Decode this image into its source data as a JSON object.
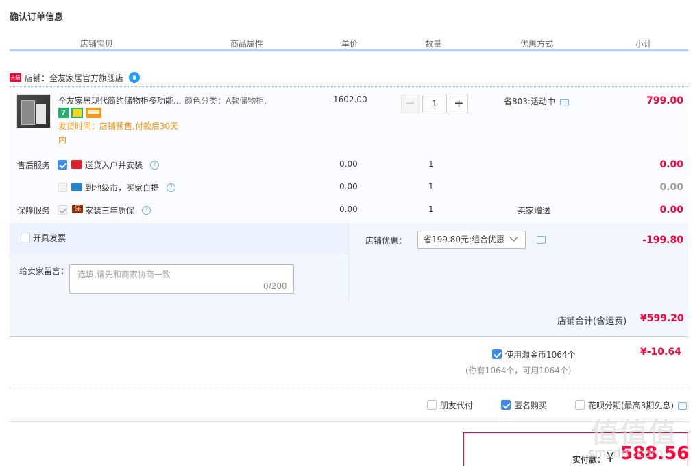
{
  "page": {
    "title": "确认订单信息"
  },
  "table_headers": [
    "店铺宝贝",
    "商品属性",
    "单价",
    "数量",
    "优惠方式",
    "小计"
  ],
  "shop": {
    "badge": "天猫",
    "label": "店铺：全友家居官方旗舰店"
  },
  "item": {
    "name": "全友家居现代简约储物柜多功能...",
    "sku": "颜色分类：A款储物柜,",
    "badge_number": "7",
    "ship_note": "发货时间：店铺预售,付款后30天内",
    "unit_price": "1602.00",
    "quantity": "1",
    "promo": "省803:活动中",
    "subtotal": "799.00"
  },
  "services": {
    "after_sale_label": "售后服务",
    "guarantee_label": "保障服务",
    "rows": [
      {
        "text": "送货入户并安装",
        "price": "0.00",
        "qty": "1",
        "promo": "",
        "subtotal": "0.00"
      },
      {
        "text": "到地级市，买家自提",
        "price": "0.00",
        "qty": "1",
        "promo": "",
        "subtotal": "0.00"
      },
      {
        "text": "家装三年质保",
        "price": "0.00",
        "qty": "1",
        "promo": "卖家赠送",
        "subtotal": "0.00"
      }
    ],
    "bao_glyph": "保"
  },
  "invoice": {
    "label": "开具发票"
  },
  "message": {
    "label": "给卖家留言：",
    "placeholder": "选填,请先和商家协商一致",
    "count": "0/200"
  },
  "shop_discount": {
    "label": "店铺优惠：",
    "selected": "省199.80元:组合优惠",
    "value": "-199.80"
  },
  "shop_total": {
    "label": "店铺合计(含运费)",
    "value": "¥599.20"
  },
  "coins": {
    "label": "使用淘金币1064个",
    "value": "¥-10.64",
    "note": "(你有1064个，可用1064个)"
  },
  "options": {
    "friend_pay": "朋友代付",
    "anonymous": "匿名购买",
    "huabei": "花呗分期(最高3期免息)"
  },
  "payment": {
    "label": "实付款：",
    "currency": "¥",
    "value": "588.56"
  },
  "watermark": {
    "text": "值值值",
    "sub": "smzdm.com"
  },
  "colors": {
    "accent": "#ff0036",
    "header_line": "#b2d1ff",
    "panel": "#f2f7ff",
    "check": "#3e8af3"
  }
}
